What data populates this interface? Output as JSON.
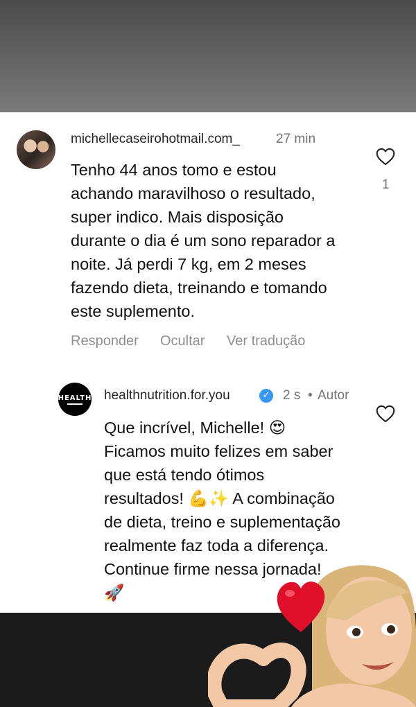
{
  "comment": {
    "username": "michellecaseirohotmail.com_",
    "time": "27 min",
    "text": "Tenho 44 anos tomo e estou\nachando maravilhoso o resultado,\nsuper indico. Mais disposição\ndurante o dia é um sono reparador a\nnoite. Já perdi 7 kg, em 2 meses\nfazendo dieta, treinando e tomando\neste suplemento.",
    "like_count": "1",
    "actions": [
      "Responder",
      "Ocultar",
      "Ver tradução"
    ],
    "like_icon": "heart-outline-icon"
  },
  "reply": {
    "username": "healthnutrition.for.you",
    "time": "2 s",
    "separator": "•",
    "author_label": "Autor",
    "avatar_text": "HEALTH",
    "verified_icon": "verified-badge-icon",
    "text": "Que incrível, Michelle! 😍\nFicamos muito felizes em saber\nque está tendo ótimos\nresultados! 💪✨ A combinação\nde dieta, treino e suplementação\nrealmente faz toda a diferença.\nContinue firme nessa jornada!\n🚀",
    "like_icon": "heart-outline-icon"
  },
  "colors": {
    "top_band": "#5f5f5f",
    "bottom_band": "#1b1b1b",
    "verified": "#3897f0",
    "sticker_heart": "#e0102a"
  }
}
